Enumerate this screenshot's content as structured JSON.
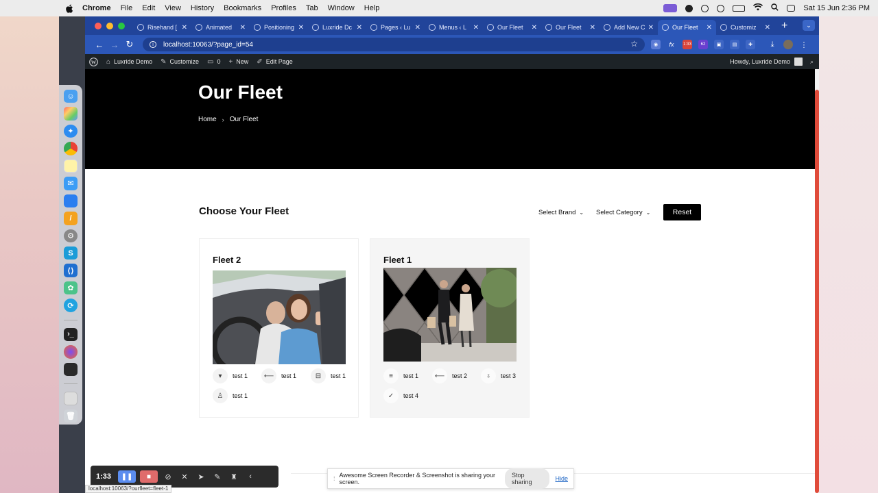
{
  "menubar": {
    "app_name": "Chrome",
    "items": [
      "File",
      "Edit",
      "View",
      "History",
      "Bookmarks",
      "Profiles",
      "Tab",
      "Window",
      "Help"
    ],
    "clock": "Sat 15 Jun  2:36 PM"
  },
  "browser": {
    "tabs": [
      {
        "label": "Risehand ["
      },
      {
        "label": "Animated"
      },
      {
        "label": "Positioning"
      },
      {
        "label": "Luxride Dc"
      },
      {
        "label": "Pages ‹ Lu"
      },
      {
        "label": "Menus ‹ L"
      },
      {
        "label": "Our Fleet"
      },
      {
        "label": "Our Fleet"
      },
      {
        "label": "Add New C"
      },
      {
        "label": "Our Fleet"
      },
      {
        "label": "Customiz"
      }
    ],
    "url": "localhost:10063/?page_id=54",
    "ext_badges": {
      "recorder": "1:33",
      "counter": "62"
    }
  },
  "wpadmin": {
    "site_name": "Luxride Demo",
    "customize": "Customize",
    "comments": "0",
    "new": "New",
    "edit_page": "Edit Page",
    "howdy": "Howdy, Luxride Demo"
  },
  "page": {
    "title": "Our Fleet",
    "breadcrumb": {
      "home": "Home",
      "current": "Our Fleet"
    },
    "section_title": "Choose Your Fleet",
    "filters": {
      "brand": "Select Brand",
      "category": "Select Category"
    },
    "reset_label": "Reset",
    "cards": [
      {
        "title": "Fleet 2",
        "features": [
          {
            "icon": "chevron-down-icon",
            "label": "test 1"
          },
          {
            "icon": "arrow-left-icon",
            "label": "test 1"
          },
          {
            "icon": "car-seat-icon",
            "label": "test 1"
          },
          {
            "icon": "person-icon",
            "label": "test 1"
          }
        ]
      },
      {
        "title": "Fleet 1",
        "features": [
          {
            "icon": "menu-lines-icon",
            "label": "test 1"
          },
          {
            "icon": "arrow-left-icon",
            "label": "test 2"
          },
          {
            "icon": "bulb-icon",
            "label": "test 3"
          },
          {
            "icon": "check-icon",
            "label": "test 4"
          }
        ]
      }
    ]
  },
  "recorder": {
    "time": "1:33",
    "sharing_text": "Awesome Screen Recorder & Screenshot is sharing your screen.",
    "stop_sharing": "Stop sharing",
    "hide": "Hide"
  },
  "status_url": "localhost:10063/?ourfleet=fleet-1",
  "colors": {
    "chrome_blue": "#2c57b8",
    "wp_bar": "#1d2327",
    "hero_bg": "#000000",
    "reset_bg": "#000000"
  }
}
